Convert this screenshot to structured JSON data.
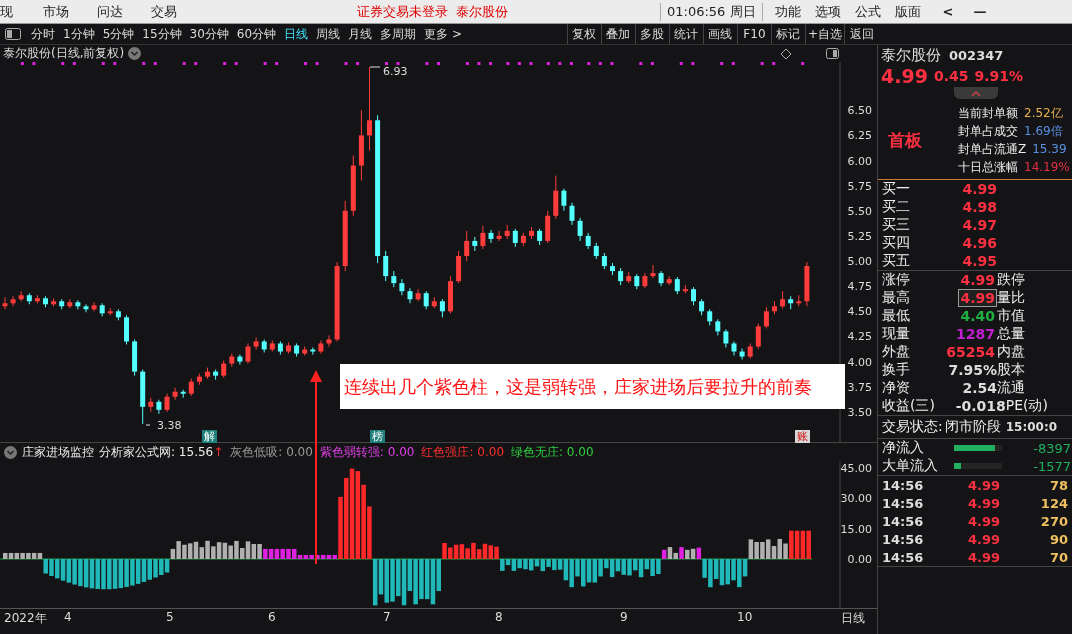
{
  "menu_bar": {
    "items": [
      "现",
      "市场",
      "问达",
      "交易"
    ],
    "login_status": "证券交易未登录",
    "stock_name": "泰尔股份",
    "clock": "01:06:56 周日",
    "menus": [
      "功能",
      "选项",
      "公式",
      "版面"
    ],
    "back": "<",
    "minimize": "—"
  },
  "toolbar": {
    "periods": [
      {
        "label": "分时",
        "selected": false
      },
      {
        "label": "1分钟",
        "selected": false
      },
      {
        "label": "5分钟",
        "selected": false
      },
      {
        "label": "15分钟",
        "selected": false
      },
      {
        "label": "30分钟",
        "selected": false
      },
      {
        "label": "60分钟",
        "selected": false
      },
      {
        "label": "日线",
        "selected": true
      },
      {
        "label": "周线",
        "selected": false
      },
      {
        "label": "月线",
        "selected": false
      },
      {
        "label": "多周期",
        "selected": false
      },
      {
        "label": "更多 >",
        "selected": false
      }
    ],
    "actions": [
      "复权",
      "叠加",
      "多股",
      "统计",
      "画线",
      "F10",
      "标记",
      "+自选",
      "返回"
    ]
  },
  "chart": {
    "title": "泰尔股份(日线,前复权)",
    "high_label": "6.93",
    "low_label": "3.38",
    "chart_data": {
      "type": "candlestick",
      "ylim": [
        3.19,
        6.98
      ],
      "yticks": [
        {
          "value": 6.5,
          "label": "6.50"
        },
        {
          "value": 6.25,
          "label": "6.25"
        },
        {
          "value": 6.0,
          "label": "6.00"
        },
        {
          "value": 5.75,
          "label": "5.75"
        },
        {
          "value": 5.5,
          "label": "5.50"
        },
        {
          "value": 5.25,
          "label": "5.25"
        },
        {
          "value": 5.0,
          "label": "5.00"
        },
        {
          "value": 4.75,
          "label": "4.75"
        },
        {
          "value": 4.5,
          "label": "4.50"
        },
        {
          "value": 4.25,
          "label": "4.25"
        },
        {
          "value": 4.0,
          "label": "4.00"
        },
        {
          "value": 3.75,
          "label": "3.75"
        },
        {
          "value": 3.5,
          "label": "3.50"
        }
      ],
      "ohlc": [
        [
          4.55,
          4.64,
          4.52,
          4.58
        ],
        [
          4.58,
          4.65,
          4.55,
          4.62
        ],
        [
          4.62,
          4.7,
          4.6,
          4.66
        ],
        [
          4.66,
          4.68,
          4.57,
          4.6
        ],
        [
          4.6,
          4.66,
          4.58,
          4.63
        ],
        [
          4.63,
          4.65,
          4.54,
          4.57
        ],
        [
          4.57,
          4.63,
          4.55,
          4.6
        ],
        [
          4.6,
          4.62,
          4.52,
          4.55
        ],
        [
          4.55,
          4.62,
          4.53,
          4.59
        ],
        [
          4.59,
          4.61,
          4.52,
          4.55
        ],
        [
          4.55,
          4.57,
          4.49,
          4.52
        ],
        [
          4.52,
          4.59,
          4.5,
          4.56
        ],
        [
          4.56,
          4.58,
          4.45,
          4.48
        ],
        [
          4.48,
          4.53,
          4.46,
          4.5
        ],
        [
          4.5,
          4.52,
          4.41,
          4.44
        ],
        [
          4.44,
          4.46,
          4.17,
          4.2
        ],
        [
          4.2,
          4.22,
          3.86,
          3.9
        ],
        [
          3.9,
          3.92,
          3.38,
          3.55
        ],
        [
          3.55,
          3.64,
          3.5,
          3.6
        ],
        [
          3.6,
          3.62,
          3.48,
          3.52
        ],
        [
          3.52,
          3.68,
          3.5,
          3.65
        ],
        [
          3.65,
          3.74,
          3.62,
          3.7
        ],
        [
          3.7,
          3.72,
          3.64,
          3.68
        ],
        [
          3.68,
          3.83,
          3.66,
          3.8
        ],
        [
          3.8,
          3.88,
          3.77,
          3.85
        ],
        [
          3.85,
          3.94,
          3.83,
          3.9
        ],
        [
          3.9,
          3.92,
          3.82,
          3.86
        ],
        [
          3.86,
          4.01,
          3.84,
          3.98
        ],
        [
          3.98,
          4.08,
          3.95,
          4.05
        ],
        [
          4.05,
          4.07,
          3.97,
          4.0
        ],
        [
          4.0,
          4.18,
          3.98,
          4.15
        ],
        [
          4.15,
          4.24,
          4.12,
          4.2
        ],
        [
          4.2,
          4.22,
          4.09,
          4.12
        ],
        [
          4.12,
          4.21,
          4.1,
          4.18
        ],
        [
          4.18,
          4.2,
          4.07,
          4.1
        ],
        [
          4.1,
          4.19,
          4.08,
          4.16
        ],
        [
          4.16,
          4.18,
          4.05,
          4.08
        ],
        [
          4.08,
          4.15,
          4.06,
          4.12
        ],
        [
          4.12,
          4.14,
          4.07,
          4.1
        ],
        [
          4.1,
          4.21,
          4.08,
          4.18
        ],
        [
          4.18,
          4.26,
          4.15,
          4.22
        ],
        [
          4.22,
          4.99,
          4.2,
          4.95
        ],
        [
          4.95,
          5.6,
          4.9,
          5.5
        ],
        [
          5.5,
          6.05,
          5.45,
          5.95
        ],
        [
          5.95,
          6.5,
          5.8,
          6.25
        ],
        [
          6.25,
          6.93,
          6.1,
          6.4
        ],
        [
          6.4,
          6.45,
          4.98,
          5.05
        ],
        [
          5.05,
          5.1,
          4.8,
          4.85
        ],
        [
          4.85,
          4.9,
          4.74,
          4.78
        ],
        [
          4.78,
          4.82,
          4.66,
          4.7
        ],
        [
          4.7,
          4.73,
          4.58,
          4.62
        ],
        [
          4.62,
          4.72,
          4.6,
          4.68
        ],
        [
          4.68,
          4.7,
          4.52,
          4.55
        ],
        [
          4.55,
          4.64,
          4.53,
          4.6
        ],
        [
          4.6,
          4.62,
          4.44,
          4.5
        ],
        [
          4.5,
          4.85,
          4.48,
          4.8
        ],
        [
          4.8,
          5.1,
          4.78,
          5.05
        ],
        [
          5.05,
          5.3,
          5.0,
          5.2
        ],
        [
          5.2,
          5.24,
          5.1,
          5.15
        ],
        [
          5.15,
          5.35,
          5.12,
          5.28
        ],
        [
          5.28,
          5.31,
          5.18,
          5.22
        ],
        [
          5.22,
          5.3,
          5.2,
          5.25
        ],
        [
          5.25,
          5.36,
          5.22,
          5.3
        ],
        [
          5.3,
          5.32,
          5.14,
          5.18
        ],
        [
          5.18,
          5.28,
          5.15,
          5.25
        ],
        [
          5.25,
          5.34,
          5.22,
          5.3
        ],
        [
          5.3,
          5.32,
          5.16,
          5.2
        ],
        [
          5.2,
          5.5,
          5.18,
          5.45
        ],
        [
          5.45,
          5.85,
          5.42,
          5.7
        ],
        [
          5.7,
          5.72,
          5.5,
          5.55
        ],
        [
          5.55,
          5.58,
          5.36,
          5.4
        ],
        [
          5.4,
          5.43,
          5.2,
          5.25
        ],
        [
          5.25,
          5.28,
          5.12,
          5.15
        ],
        [
          5.15,
          5.18,
          5.02,
          5.05
        ],
        [
          5.05,
          5.08,
          4.92,
          4.95
        ],
        [
          4.95,
          4.98,
          4.86,
          4.9
        ],
        [
          4.9,
          4.93,
          4.76,
          4.8
        ],
        [
          4.8,
          4.89,
          4.78,
          4.85
        ],
        [
          4.85,
          4.87,
          4.72,
          4.75
        ],
        [
          4.75,
          4.88,
          4.73,
          4.85
        ],
        [
          4.85,
          4.96,
          4.83,
          4.88
        ],
        [
          4.88,
          4.9,
          4.75,
          4.78
        ],
        [
          4.78,
          4.85,
          4.76,
          4.82
        ],
        [
          4.82,
          4.84,
          4.67,
          4.7
        ],
        [
          4.7,
          4.76,
          4.68,
          4.72
        ],
        [
          4.72,
          4.74,
          4.56,
          4.6
        ],
        [
          4.6,
          4.62,
          4.46,
          4.5
        ],
        [
          4.5,
          4.52,
          4.36,
          4.4
        ],
        [
          4.4,
          4.42,
          4.26,
          4.3
        ],
        [
          4.3,
          4.32,
          4.14,
          4.18
        ],
        [
          4.18,
          4.2,
          4.06,
          4.1
        ],
        [
          4.1,
          4.13,
          4.02,
          4.05
        ],
        [
          4.05,
          4.18,
          4.03,
          4.15
        ],
        [
          4.15,
          4.38,
          4.13,
          4.35
        ],
        [
          4.35,
          4.54,
          4.33,
          4.5
        ],
        [
          4.5,
          4.6,
          4.47,
          4.55
        ],
        [
          4.55,
          4.7,
          4.53,
          4.62
        ],
        [
          4.62,
          4.65,
          4.52,
          4.58
        ],
        [
          4.58,
          4.66,
          4.55,
          4.6
        ],
        [
          4.6,
          4.99,
          4.55,
          4.95
        ]
      ]
    },
    "markers": [
      {
        "label": "解",
        "color": "#1f7f7a"
      },
      {
        "label": "榜",
        "color": "#1f7f7a"
      },
      {
        "label": "账",
        "color": "#d8d8d8"
      }
    ],
    "annotation": "连续出几个紫色柱，这是弱转强，庄家进场后要拉升的前奏"
  },
  "indicator": {
    "name": "庄家进场监控",
    "source_label": "分析家公式网:",
    "source_value": "15.56",
    "trend": "↑",
    "legend": [
      {
        "label": "灰色低吸:",
        "value": "0.00",
        "color": "#9a9a9a"
      },
      {
        "label": "紫色弱转强:",
        "value": "0.00",
        "color": "#e040e8"
      },
      {
        "label": "红色强庄:",
        "value": "0.00",
        "color": "#ff3030"
      },
      {
        "label": "绿色无庄:",
        "value": "0.00",
        "color": "#30d040"
      }
    ],
    "axis": [
      "45.00",
      "30.00",
      "15.00",
      "0.00"
    ]
  },
  "x_axis": {
    "labels": [
      "2022年",
      "4",
      "5",
      "6",
      "7",
      "8",
      "9",
      "10"
    ],
    "period": "日线"
  },
  "quote": {
    "name": "泰尔股份",
    "code": "002347",
    "price": "4.99",
    "change": "0.45",
    "change_pct": "9.91%",
    "board": {
      "title": "首板",
      "rows": [
        {
          "label": "当前封单额",
          "value": "2.52亿",
          "color": "#e8b050"
        },
        {
          "label": "封单占成交",
          "value": "1.69倍",
          "color": "#5a90e0"
        },
        {
          "label": "封单占流通Z",
          "value": "15.39",
          "color": "#5a90e0"
        },
        {
          "label": "十日总涨幅",
          "value": "14.19%",
          "color": "#e03040"
        }
      ]
    },
    "bids": [
      {
        "label": "买一",
        "price": "4.99"
      },
      {
        "label": "买二",
        "price": "4.98"
      },
      {
        "label": "买三",
        "price": "4.97"
      },
      {
        "label": "买四",
        "price": "4.96"
      },
      {
        "label": "买五",
        "price": "4.95"
      }
    ],
    "stats": [
      {
        "label": "涨停",
        "value": "4.99",
        "color": "#ff3040",
        "boxed": false,
        "label2": "跌停"
      },
      {
        "label": "最高",
        "value": "4.99",
        "color": "#ff3040",
        "boxed": true,
        "label2": "量比"
      },
      {
        "label": "最低",
        "value": "4.40",
        "color": "#20b040",
        "boxed": false,
        "label2": "市值"
      },
      {
        "label": "现量",
        "value": "1287",
        "color": "#c020d0",
        "boxed": false,
        "label2": "总量"
      },
      {
        "label": "外盘",
        "value": "65254",
        "color": "#ff3040",
        "boxed": false,
        "label2": "内盘"
      }
    ],
    "fundamentals": [
      {
        "label": "换手",
        "value": "7.95%",
        "label2": "股本"
      },
      {
        "label": "净资",
        "value": "2.54",
        "label2": "流通"
      },
      {
        "label": "收益(三)",
        "value": "-0.018",
        "label2": "PE(动)"
      }
    ],
    "status": {
      "label": "交易状态:",
      "value": "闭市阶段",
      "time": "15:00:0"
    },
    "flows": [
      {
        "label": "净流入",
        "level": 0.85,
        "value": "-8397"
      },
      {
        "label": "大单流入",
        "level": 0.15,
        "value": "-1577"
      }
    ],
    "ticks": [
      {
        "time": "14:56",
        "price": "4.99",
        "volume": "78"
      },
      {
        "time": "14:56",
        "price": "4.99",
        "volume": "124"
      },
      {
        "time": "14:56",
        "price": "4.99",
        "volume": "270"
      },
      {
        "time": "14:56",
        "price": "4.99",
        "volume": "90"
      },
      {
        "time": "14:56",
        "price": "4.99",
        "volume": "70"
      }
    ]
  }
}
